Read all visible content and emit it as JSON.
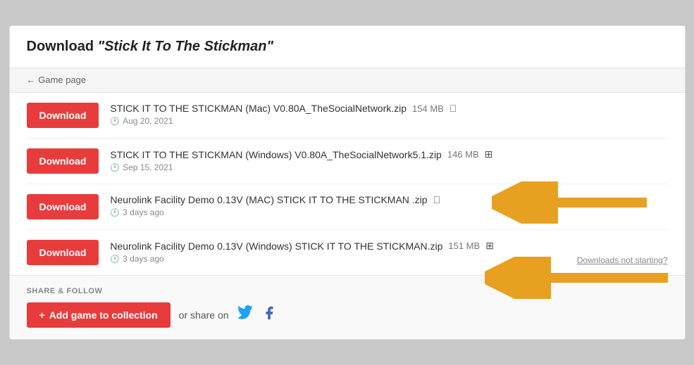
{
  "page": {
    "title_prefix": "Download ",
    "title_quoted": "\"Stick It To The Stickman\"",
    "back_link": "← Game page"
  },
  "downloads": [
    {
      "button_label": "Download",
      "file_name": "STICK IT TO THE STICKMAN (Mac) V0.80A_TheSocialNetwork.zip",
      "file_size": "154 MB",
      "platform": "mac",
      "date": "Aug 20, 2021",
      "has_arrow": false
    },
    {
      "button_label": "Download",
      "file_name": "STICK IT TO THE STICKMAN (Windows) V0.80A_TheSocialNetwork5.1.zip",
      "file_size": "146 MB",
      "platform": "windows",
      "date": "Sep 15, 2021",
      "has_arrow": false
    },
    {
      "button_label": "Download",
      "file_name": "Neurolink Facility Demo 0.13V (MAC) STICK IT TO THE STICKMAN .zip",
      "file_size": "",
      "platform": "mac",
      "date": "3 days ago",
      "has_arrow": true
    },
    {
      "button_label": "Download",
      "file_name": "Neurolink Facility Demo 0.13V (Windows) STICK IT TO THE STICKMAN.zip",
      "file_size": "151 MB",
      "platform": "windows",
      "date": "3 days ago",
      "has_arrow": true,
      "downloads_not_starting": "Downloads not starting?"
    }
  ],
  "share": {
    "section_label": "SHARE & FOLLOW",
    "add_collection_icon": "+",
    "add_collection_label": "Add game to collection",
    "or_share_text": "or share on"
  },
  "icons": {
    "mac": "🍎",
    "windows": "⊞",
    "twitter": "🐦",
    "facebook": "f",
    "clock": "🕐"
  }
}
